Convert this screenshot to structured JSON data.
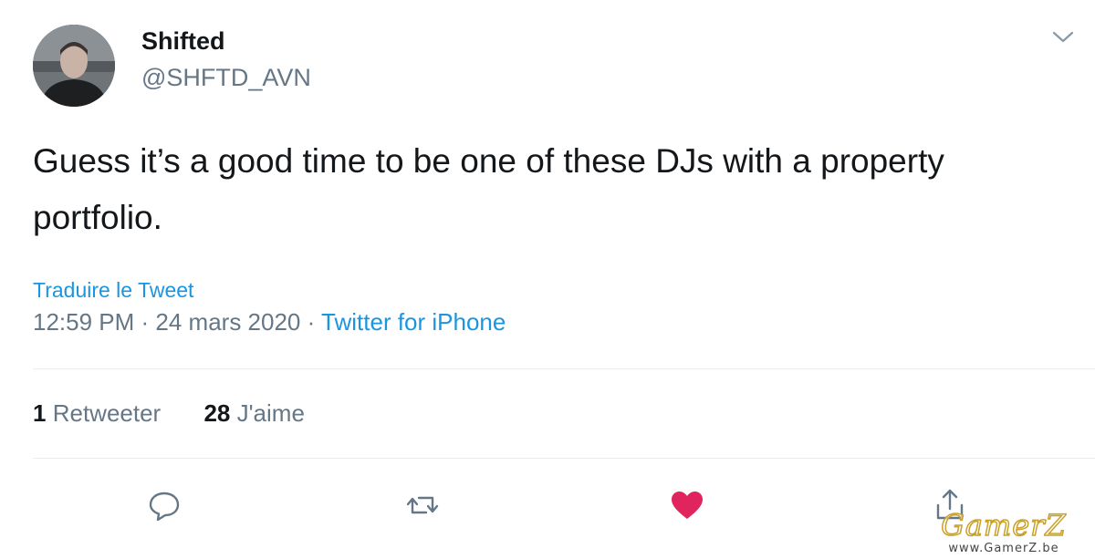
{
  "author": {
    "name": "Shifted",
    "handle": "@SHFTD_AVN",
    "avatar_icon": "user-photo"
  },
  "tweet": {
    "text": "Guess it’s a good time to be one of these DJs with a property portfolio."
  },
  "translate_label": "Traduire le Tweet",
  "meta": {
    "time": "12:59 PM",
    "separator": " · ",
    "date": "24 mars 2020",
    "source": "Twitter for iPhone"
  },
  "stats": {
    "retweets_count": "1",
    "retweets_label": "Retweeter",
    "likes_count": "28",
    "likes_label": "J'aime"
  },
  "actions": {
    "reply_icon": "reply-icon",
    "retweet_icon": "retweet-icon",
    "like_icon": "heart-icon",
    "share_icon": "share-icon",
    "like_color": "#e0245e"
  },
  "colors": {
    "link": "#1b95e0",
    "secondary_text": "#657786",
    "primary_text": "#14171a"
  },
  "watermark": {
    "logo_text": "GamerZ",
    "url": "www.GamerZ.be"
  }
}
